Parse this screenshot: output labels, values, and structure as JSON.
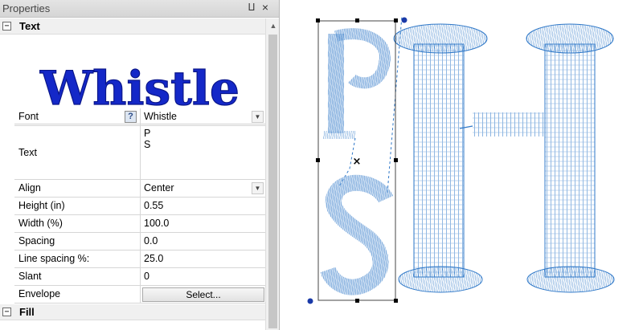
{
  "panel": {
    "title": "Properties",
    "pin_glyph": "⨿",
    "close_glyph": "×"
  },
  "sections": {
    "text": {
      "toggle": "−",
      "label": "Text"
    },
    "fill": {
      "toggle": "−",
      "label": "Fill"
    }
  },
  "preview": {
    "sample": "Whistle",
    "color": "#1428c8"
  },
  "properties": {
    "font": {
      "label": "Font",
      "value": "Whistle",
      "help": "?"
    },
    "text": {
      "label": "Text",
      "line1": "P",
      "line2": "S"
    },
    "align": {
      "label": "Align",
      "value": "Center"
    },
    "height": {
      "label": "Height (in)",
      "value": "0.55"
    },
    "width": {
      "label": "Width (%)",
      "value": "100.0"
    },
    "spacing": {
      "label": "Spacing",
      "value": "0.0"
    },
    "line_spacing": {
      "label": "Line spacing %:",
      "value": "25.0"
    },
    "slant": {
      "label": "Slant",
      "value": "0"
    },
    "envelope": {
      "label": "Envelope",
      "button": "Select..."
    }
  },
  "canvas": {
    "stitch_color": "#2f78c8",
    "handle_color": "#1a3aa8",
    "center_mark": "×"
  }
}
